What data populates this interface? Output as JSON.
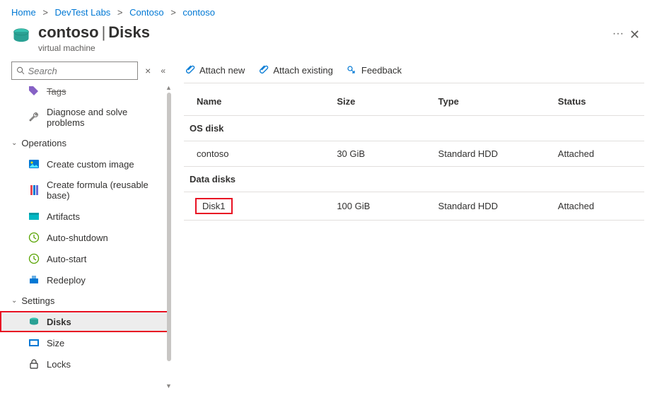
{
  "breadcrumb": {
    "items": [
      "Home",
      "DevTest Labs",
      "Contoso",
      "contoso"
    ]
  },
  "header": {
    "resource_name": "contoso",
    "section": "Disks",
    "subtitle": "virtual machine",
    "more": "···"
  },
  "search": {
    "placeholder": "Search"
  },
  "nav": {
    "tags_label": "Tags",
    "diagnose_label": "Diagnose and solve problems",
    "group_operations": "Operations",
    "create_custom_image": "Create custom image",
    "create_formula": "Create formula (reusable base)",
    "artifacts": "Artifacts",
    "auto_shutdown": "Auto-shutdown",
    "auto_start": "Auto-start",
    "redeploy": "Redeploy",
    "group_settings": "Settings",
    "disks": "Disks",
    "size": "Size",
    "locks": "Locks"
  },
  "toolbar": {
    "attach_new": "Attach new",
    "attach_existing": "Attach existing",
    "feedback": "Feedback"
  },
  "table": {
    "headers": {
      "name": "Name",
      "size": "Size",
      "type": "Type",
      "status": "Status"
    },
    "section_os": "OS disk",
    "section_data": "Data disks",
    "os_row": {
      "name": "contoso",
      "size": "30 GiB",
      "type": "Standard HDD",
      "status": "Attached"
    },
    "data_row": {
      "name": "Disk1",
      "size": "100 GiB",
      "type": "Standard HDD",
      "status": "Attached"
    }
  }
}
